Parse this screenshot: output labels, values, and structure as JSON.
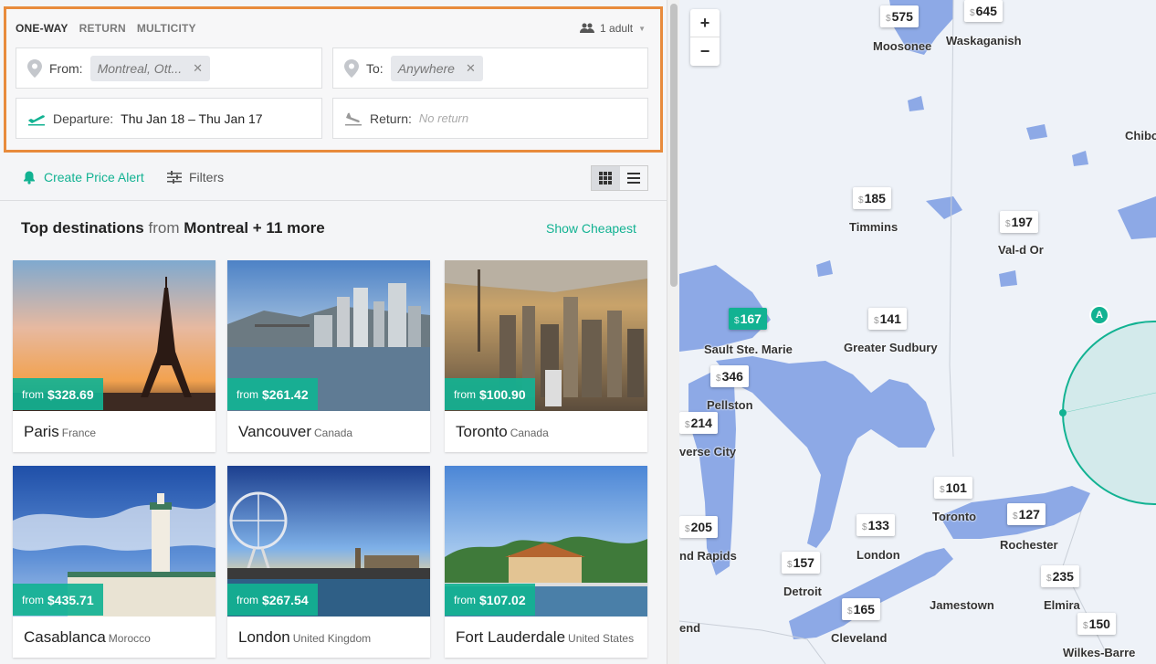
{
  "trip_types": [
    "ONE-WAY",
    "RETURN",
    "MULTICITY"
  ],
  "passengers": "1 adult",
  "from": {
    "label": "From:",
    "value": "Montreal, Ott..."
  },
  "to": {
    "label": "To:",
    "value": "Anywhere"
  },
  "departure": {
    "label": "Departure:",
    "value": "Thu Jan 18 – Thu Jan 17"
  },
  "return": {
    "label": "Return:",
    "placeholder": "No return"
  },
  "actions": {
    "alert": "Create Price Alert",
    "filters": "Filters"
  },
  "heading": {
    "prefix": "Top destinations",
    "from": "from",
    "origin": "Montreal + 11 more",
    "cheapest": "Show Cheapest"
  },
  "destinations": [
    {
      "city": "Paris",
      "country": "France",
      "price_label": "from",
      "price": "$328.69"
    },
    {
      "city": "Vancouver",
      "country": "Canada",
      "price_label": "from",
      "price": "$261.42"
    },
    {
      "city": "Toronto",
      "country": "Canada",
      "price_label": "from",
      "price": "$100.90"
    },
    {
      "city": "Casablanca",
      "country": "Morocco",
      "price_label": "from",
      "price": "$435.71"
    },
    {
      "city": "London",
      "country": "United Kingdom",
      "price_label": "from",
      "price": "$267.54"
    },
    {
      "city": "Fort Lauderdale",
      "country": "United States",
      "price_label": "from",
      "price": "$107.02"
    }
  ],
  "map": {
    "currency": "$",
    "zoom_in": "+",
    "zoom_out": "−",
    "origin_marker": "A",
    "pins": [
      {
        "city": "Moosonee",
        "price": "575"
      },
      {
        "city": "Waskaganish",
        "price": "645"
      },
      {
        "city": "Timmins",
        "price": "185"
      },
      {
        "city": "Val-d Or",
        "price": "197"
      },
      {
        "city": "Sault Ste. Marie",
        "price": "167"
      },
      {
        "city": "Greater Sudbury",
        "price": "141"
      },
      {
        "city": "Pellston",
        "price": "346"
      },
      {
        "city": "verse City",
        "price": "214"
      },
      {
        "city": "Toronto",
        "price": "101"
      },
      {
        "city": "Rochester",
        "price": "127"
      },
      {
        "city": "nd Rapids",
        "price": "205"
      },
      {
        "city": "London",
        "price": "133"
      },
      {
        "city": "Detroit",
        "price": "157"
      },
      {
        "city": "Cleveland",
        "price": "165"
      },
      {
        "city": "Elmira",
        "price": "235"
      },
      {
        "city": "Wilkes-Barre",
        "price": "150"
      }
    ],
    "labels": [
      "Chibo",
      "Jamestown",
      "end"
    ]
  }
}
